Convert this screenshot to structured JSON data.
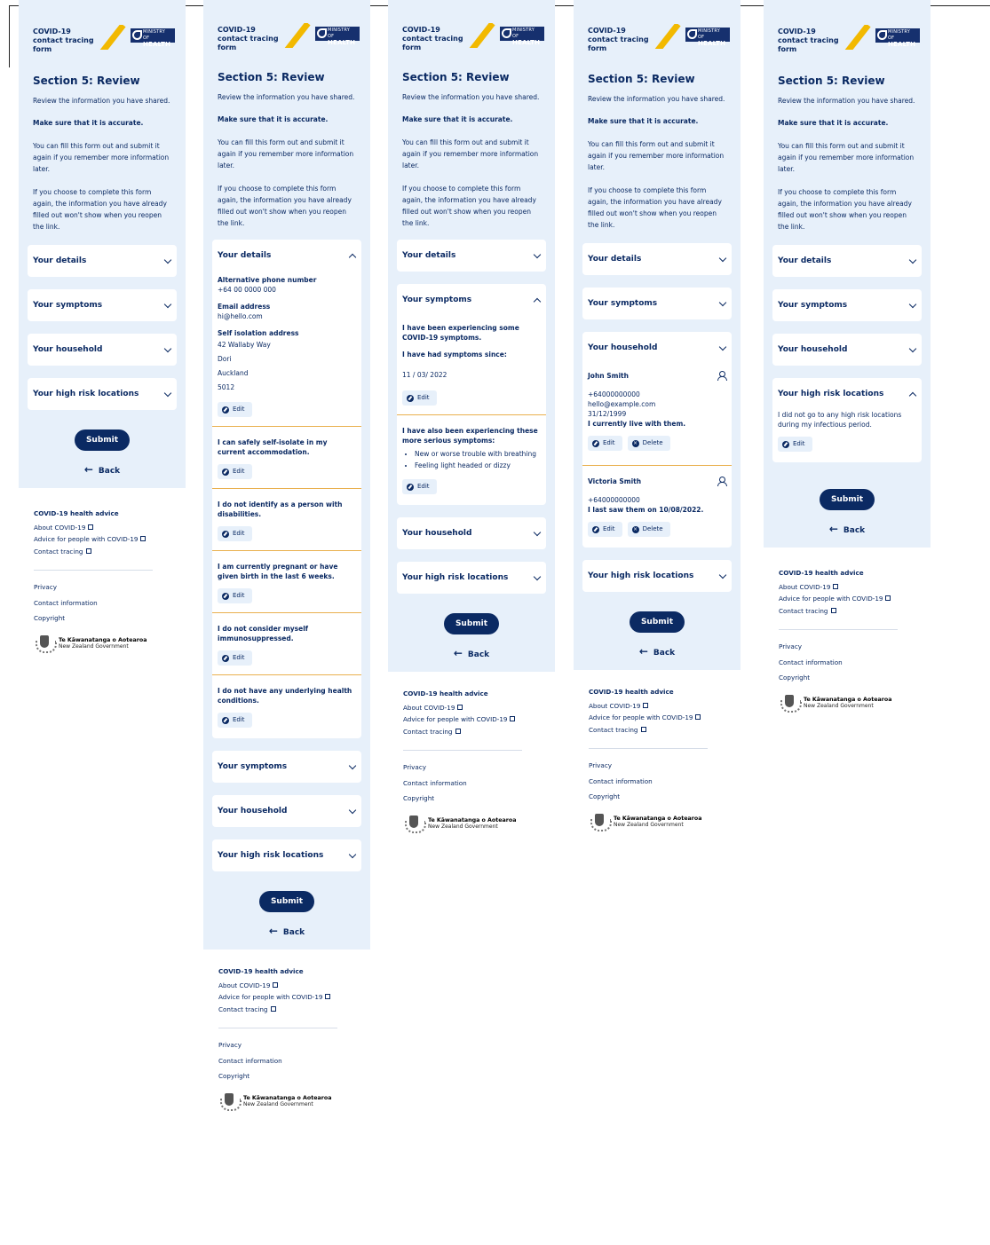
{
  "header": {
    "app_title": "COVID-19 contact tracing form",
    "logo_small": "MINISTRY OF",
    "logo_big": "HEALTH"
  },
  "section": {
    "title": "Section 5: Review",
    "intro_1": "Review the information you have shared.",
    "intro_2": "Make sure that it is accurate.",
    "intro_3": "You can fill this form out and submit it again if you remember more information later.",
    "intro_4": "If you choose to complete this form again, the information you have already filled out won't show when you reopen the link."
  },
  "accordions": {
    "details": "Your details",
    "symptoms": "Your symptoms",
    "household": "Your household",
    "locations": "Your high risk locations"
  },
  "details_body": {
    "alt_phone_label": "Alternative phone number",
    "alt_phone_value": "+64 00 0000 000",
    "email_label": "Email address",
    "email_value": "hi@hello.com",
    "address_label": "Self isolation address",
    "address_line1": "42 Wallaby Way",
    "address_line2": "Dori",
    "address_line3": "Auckland",
    "address_line4": "5012",
    "s1": "I can safely self-isolate in my current accommodation.",
    "s2": "I do not identify as a person with disabilities.",
    "s3": "I am currently pregnant or have given birth in the last 6 weeks.",
    "s4": "I do not consider myself immunosuppressed.",
    "s5": "I do not have any underlying health conditions."
  },
  "symptoms_body": {
    "line1": "I have been experiencing some COVID-19 symptoms.",
    "line2": "I have had symptoms since:",
    "date": "11 / 03/ 2022",
    "serious_title": "I have also been experiencing these more serious symptoms:",
    "bullet1": "New or worse trouble with breathing",
    "bullet2": "Feeling light headed or dizzy"
  },
  "household_body": {
    "p1_name": "John Smith",
    "p1_phone": "+64000000000",
    "p1_email": "hello@example.com",
    "p1_dob": "31/12/1999",
    "p1_status": "I currently live with them.",
    "p2_name": "Victoria Smith",
    "p2_phone": "+64000000000",
    "p2_status": "I last saw them on 10/08/2022."
  },
  "locations_body": {
    "text": "I did not go to any high risk locations during my infectious period."
  },
  "buttons": {
    "edit": "Edit",
    "delete": "Delete",
    "submit": "Submit",
    "back": "Back"
  },
  "footer": {
    "title": "COVID-19 health advice",
    "link1": "About COVID-19",
    "link2": "Advice for people with COVID-19",
    "link3": "Contact tracing",
    "privacy": "Privacy",
    "contact": "Contact information",
    "copyright": "Copyright",
    "gov_name": "Te Kāwanatanga o Aotearoa",
    "gov_sub": "New Zealand Government"
  },
  "colors": {
    "navy": "#0b2a63",
    "panel_bg": "#e7f0fa",
    "accent_yellow": "#f2b900",
    "divider": "#e9b04e"
  }
}
